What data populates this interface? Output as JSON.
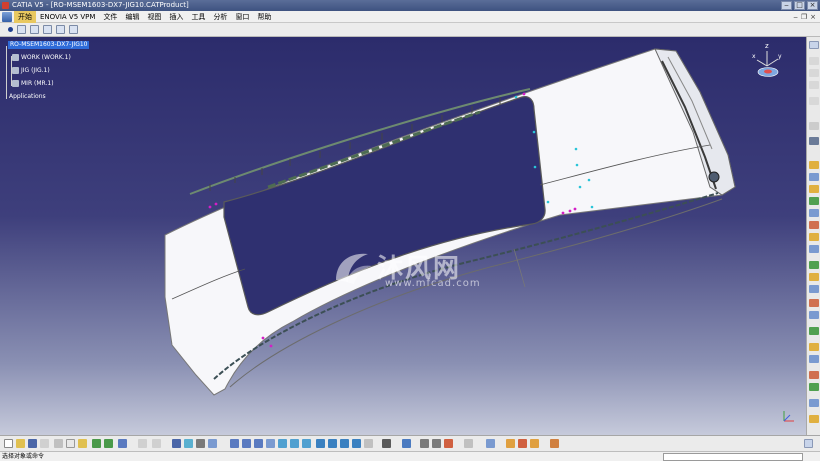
{
  "window": {
    "title": "CATIA V5 - [RO-MSEM1603-DX7-JIG10.CATProduct]"
  },
  "menubar": {
    "items": [
      "开始",
      "ENOVIA V5 VPM",
      "文件",
      "编辑",
      "视图",
      "插入",
      "工具",
      "分析",
      "窗口",
      "帮助"
    ]
  },
  "tree": {
    "root": "RO-MSEM1603-DX7-JIG10",
    "children": [
      "WORK (WORK.1)",
      "JIG (JIG.1)",
      "MIR (MR.1)"
    ],
    "applications": "Applications"
  },
  "watermark": {
    "text": "沐风网",
    "url": "www.mfcad.com"
  },
  "statusbar": {
    "prompt": "选择对象或命令",
    "command_value": ""
  },
  "colors": {
    "viewport_top": "#2c2c6c",
    "viewport_bottom": "#c6cadb",
    "selection": "#2e6bd8",
    "active_menu": "#e8c860"
  }
}
